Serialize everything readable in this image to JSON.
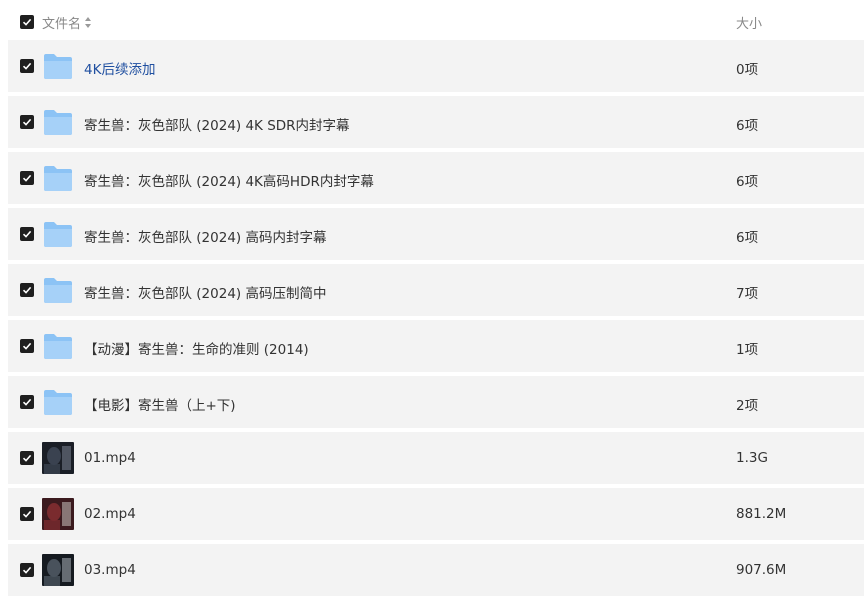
{
  "header": {
    "name_label": "文件名",
    "size_label": "大小"
  },
  "rows": [
    {
      "type": "folder",
      "name": "4K后续添加",
      "size": "0项",
      "highlight": true
    },
    {
      "type": "folder",
      "name": "寄生兽：灰色部队 (2024) 4K SDR内封字幕",
      "size": "6项"
    },
    {
      "type": "folder",
      "name": "寄生兽：灰色部队 (2024) 4K高码HDR内封字幕",
      "size": "6项"
    },
    {
      "type": "folder",
      "name": "寄生兽：灰色部队 (2024) 高码内封字幕",
      "size": "6项"
    },
    {
      "type": "folder",
      "name": "寄生兽：灰色部队 (2024) 高码压制简中",
      "size": "7项"
    },
    {
      "type": "folder",
      "name": "【动漫】寄生兽：生命的准则 (2014)",
      "size": "1项"
    },
    {
      "type": "folder",
      "name": "【电影】寄生兽（上+下)",
      "size": "2项"
    },
    {
      "type": "video",
      "name": "01.mp4",
      "size": "1.3G"
    },
    {
      "type": "video",
      "name": "02.mp4",
      "size": "881.2M"
    },
    {
      "type": "video",
      "name": "03.mp4",
      "size": "907.6M"
    }
  ],
  "colors": {
    "folder": "#8cc3f5",
    "row_bg": "#f3f3f3",
    "link": "#1f4fa0",
    "checkbox": "#1f1f1f"
  },
  "icons": {
    "checkbox": "checkmark-icon",
    "folder": "folder-icon",
    "sort": "sort-icon"
  }
}
